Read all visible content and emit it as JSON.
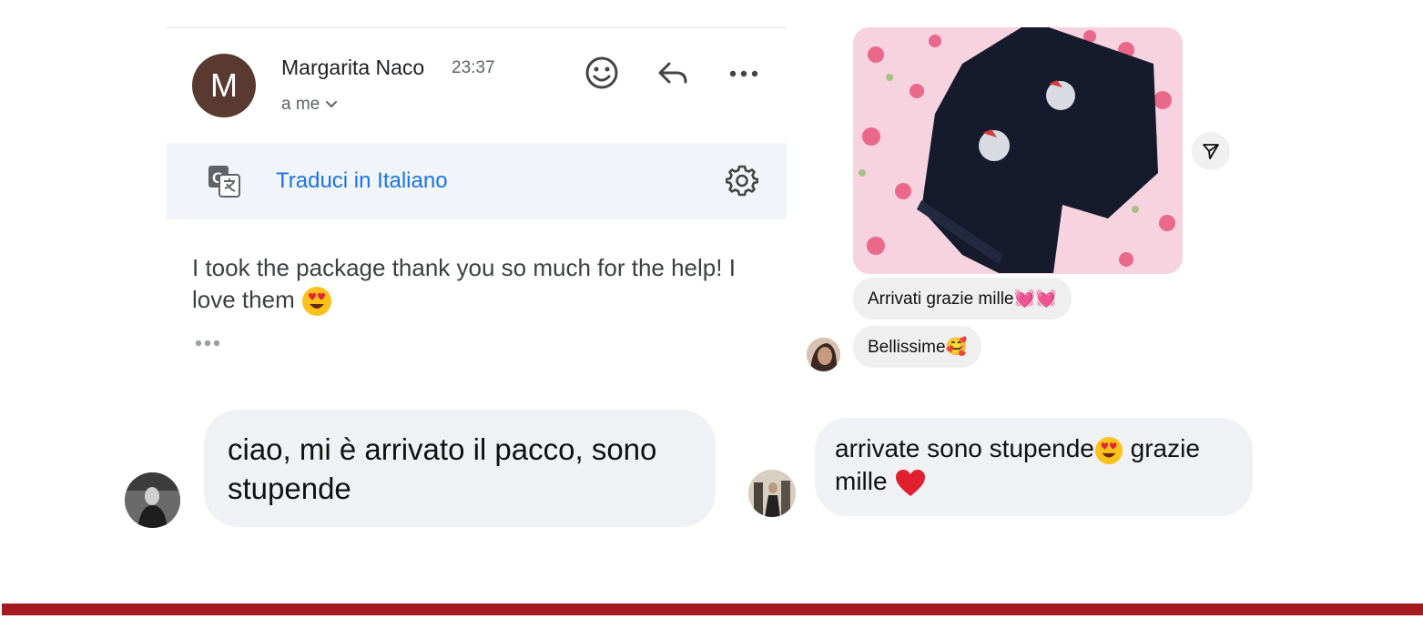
{
  "email": {
    "avatar_letter": "M",
    "sender_name": "Margarita Naco",
    "time": "23:37",
    "recipient": "a me",
    "translate_link": "Traduci in Italiano",
    "body_text": "I took the package thank you so much for the help! I love them",
    "colors": {
      "avatar_bg": "#5a3a30",
      "link": "#1a73e8",
      "translate_bar_bg": "#f1f5f9"
    },
    "icons": [
      "emoji-icon",
      "reply-icon",
      "more-icon",
      "translate-icon",
      "settings-icon",
      "chevron-down-icon",
      "ellipsis-icon"
    ]
  },
  "image_chat": {
    "message_1": "Arrivati grazie mille💓💓",
    "message_2": "Bellissime🥰",
    "icons": [
      "send-icon"
    ]
  },
  "chat_left": {
    "message": "ciao, mi è arrivato il pacco, sono stupende"
  },
  "chat_right": {
    "message_part_1": "arrivate sono stupende",
    "message_part_2": " grazie mille "
  },
  "colors": {
    "bottom_bar": "#a51a1f",
    "bubble_bg": "#f0f1f4"
  }
}
